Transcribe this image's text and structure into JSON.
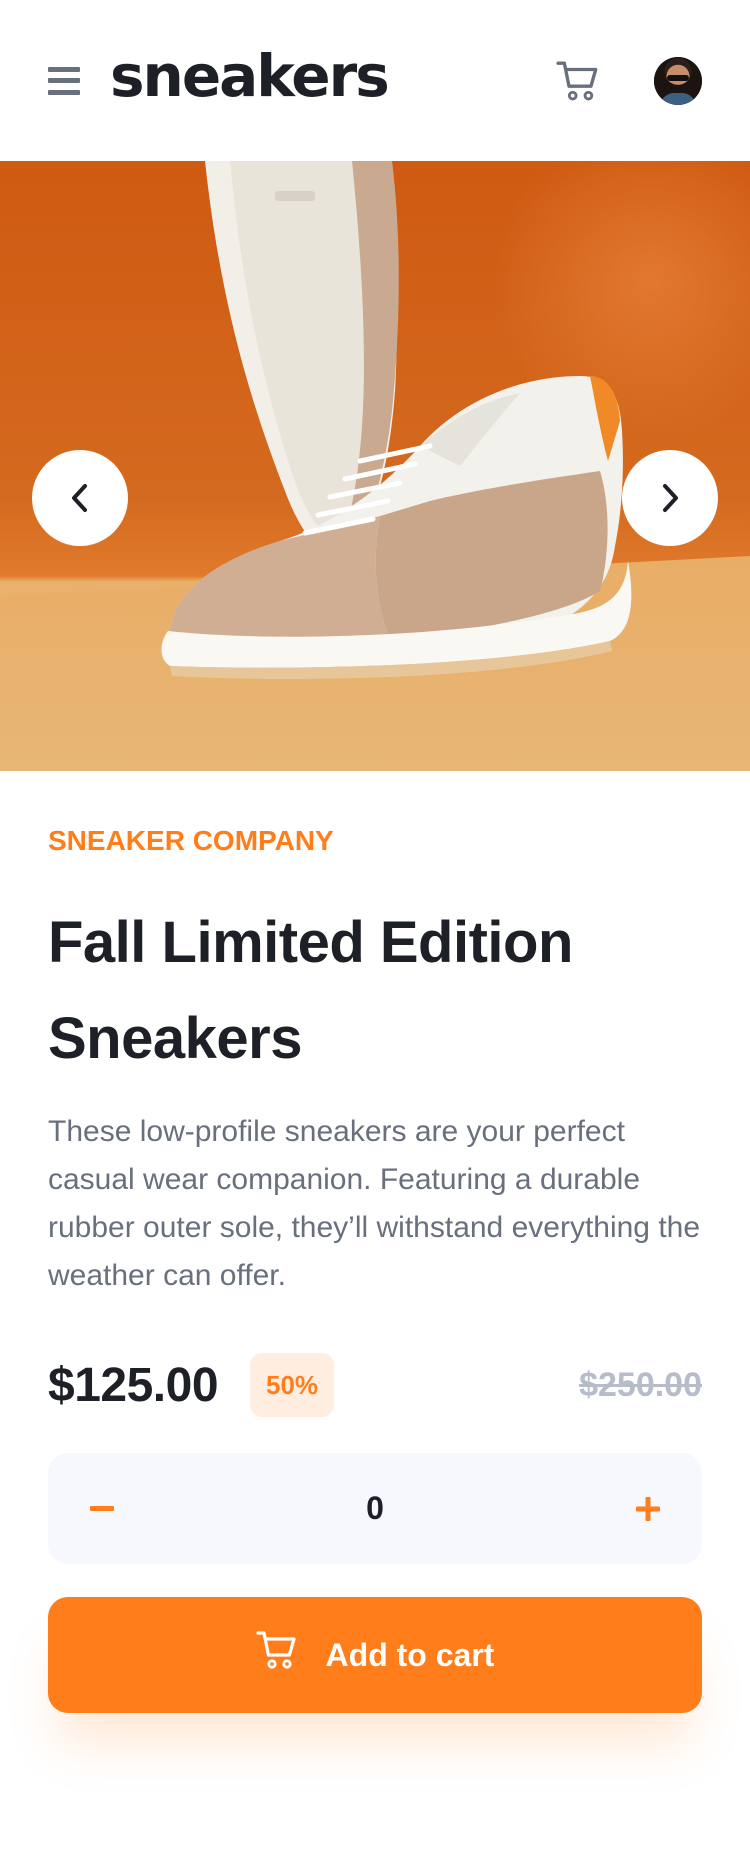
{
  "header": {
    "logo": "sneakers",
    "menu_icon": "hamburger-menu-icon",
    "cart_icon": "cart-icon",
    "avatar": "user-avatar"
  },
  "gallery": {
    "prev_icon": "chevron-left-icon",
    "next_icon": "chevron-right-icon"
  },
  "product": {
    "company": "SNEAKER COMPANY",
    "title": "Fall Limited Edition Sneakers",
    "description": "These low-profile sneakers are your perfect casual wear companion. Featuring a durable rubber outer sole, they’ll withstand everything the weather can offer.",
    "price": "$125.00",
    "discount": "50%",
    "original_price": "$250.00"
  },
  "quantity": {
    "minus_icon": "minus-icon",
    "plus_icon": "plus-icon",
    "value": "0"
  },
  "cart_button": {
    "label": "Add to cart",
    "icon": "cart-icon"
  },
  "colors": {
    "accent": "#ff7e1b",
    "accent_pale": "#ffede0",
    "text_dark": "#1d2026",
    "text_muted": "#69707d",
    "text_strike": "#b6bcc8",
    "quantity_bg": "#f6f8fd"
  }
}
